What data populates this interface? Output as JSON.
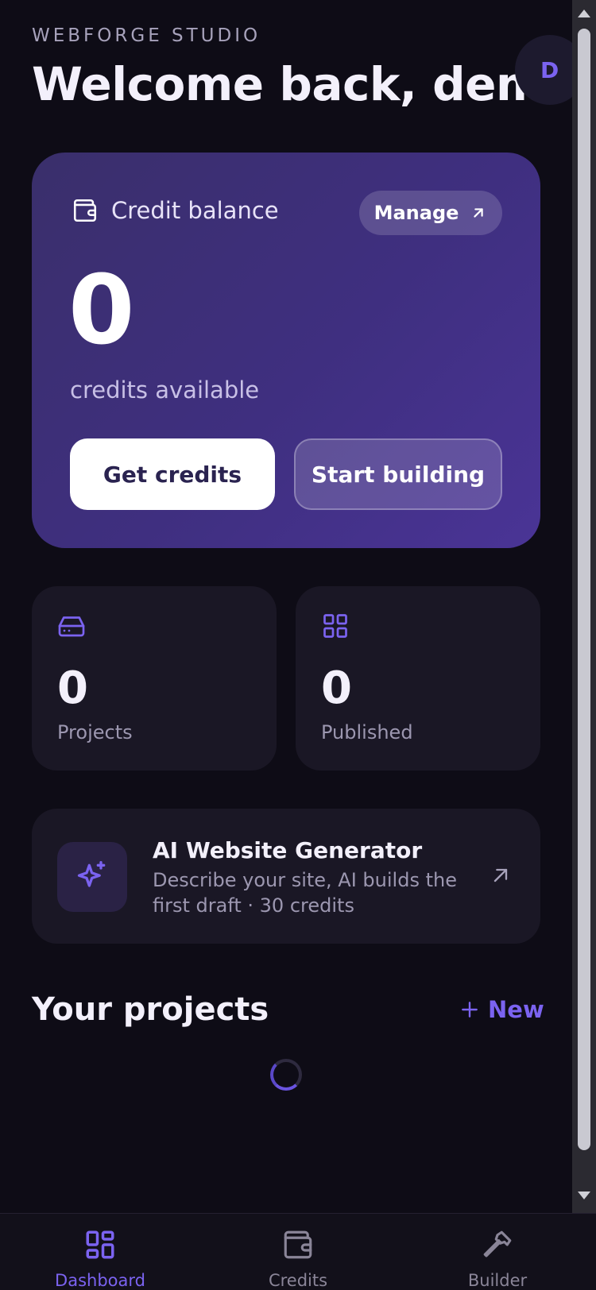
{
  "header": {
    "eyebrow": "WEBFORGE STUDIO",
    "greeting": "Welcome back, demo",
    "avatar_initial": "D"
  },
  "credit_card": {
    "title": "Credit balance",
    "manage_label": "Manage",
    "balance": "0",
    "balance_caption": "credits available",
    "get_credits_label": "Get credits",
    "start_building_label": "Start building"
  },
  "stats": [
    {
      "value": "0",
      "label": "Projects",
      "icon": "drive-icon"
    },
    {
      "value": "0",
      "label": "Published",
      "icon": "grid-icon"
    }
  ],
  "ai_generator": {
    "title": "AI Website Generator",
    "description": "Describe your site, AI builds the first draft · 30 credits",
    "icon": "sparkles-icon"
  },
  "projects": {
    "title": "Your projects",
    "new_label": "New",
    "loading": true
  },
  "bottom_nav": [
    {
      "label": "Dashboard",
      "icon": "dashboard-icon",
      "active": true
    },
    {
      "label": "Credits",
      "icon": "wallet-icon",
      "active": false
    },
    {
      "label": "Builder",
      "icon": "hammer-icon",
      "active": false
    }
  ],
  "colors": {
    "background": "#0e0c16",
    "accent": "#7b63f0",
    "card": "#1a1725",
    "credit_card_start": "#3a2f6b",
    "credit_card_end": "#4a3496"
  }
}
